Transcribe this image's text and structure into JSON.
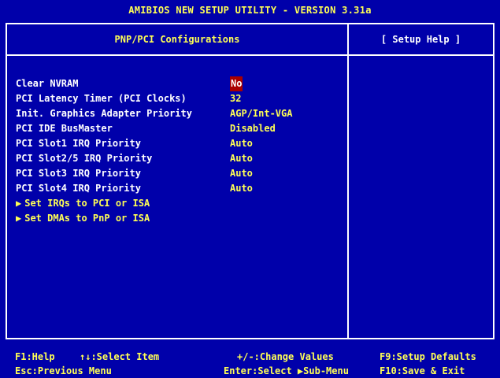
{
  "title": "AMIBIOS NEW SETUP UTILITY - VERSION 3.31a",
  "section_title": "PNP/PCI Configurations",
  "help_title": "[  Setup Help  ]",
  "items": [
    {
      "label": "Clear NVRAM",
      "value": "No",
      "selected": true
    },
    {
      "label": "PCI Latency Timer (PCI Clocks)",
      "value": "32"
    },
    {
      "label": "Init. Graphics Adapter Priority",
      "value": "AGP/Int-VGA"
    },
    {
      "label": "PCI IDE BusMaster",
      "value": "Disabled"
    },
    {
      "label": "PCI Slot1 IRQ Priority",
      "value": "Auto"
    },
    {
      "label": "PCI Slot2/5 IRQ Priority",
      "value": "Auto"
    },
    {
      "label": "PCI Slot3 IRQ Priority",
      "value": "Auto"
    },
    {
      "label": "PCI Slot4 IRQ Priority",
      "value": "Auto"
    }
  ],
  "submenus": [
    {
      "arrow": "▶",
      "label": "Set IRQs to PCI or ISA"
    },
    {
      "arrow": "▶",
      "label": "Set DMAs to PnP or ISA"
    }
  ],
  "footer": {
    "f1": "F1:Help",
    "select_item": "↑↓:Select Item",
    "change_values": "+/-:Change Values",
    "f9": "F9:Setup Defaults",
    "esc": "Esc:Previous Menu",
    "enter": "Enter:Select ▶Sub-Menu",
    "f10": "F10:Save & Exit"
  },
  "colors": {
    "background": "#0000aa",
    "title_text": "#ffff55",
    "selected_bg": "#aa0000"
  }
}
